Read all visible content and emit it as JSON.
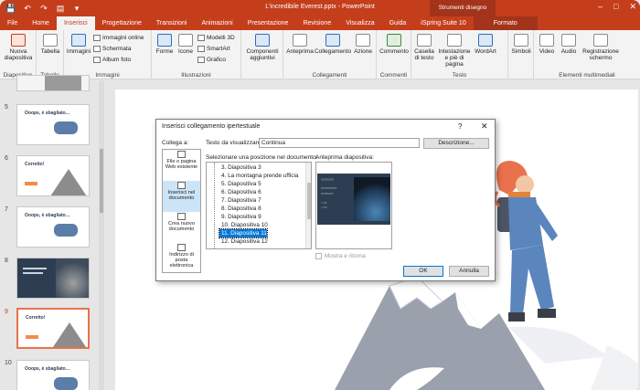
{
  "window": {
    "title": "L'incredibile Everest.pptx - PowerPoint",
    "context_group": "Strumenti disegno",
    "controls": [
      "–",
      "□",
      "✕"
    ]
  },
  "qat": [
    "💾",
    "↶",
    "↷",
    "▤",
    "▾"
  ],
  "tabs": [
    "File",
    "Home",
    "Inserisci",
    "Progettazione",
    "Transizioni",
    "Animazioni",
    "Presentazione",
    "Revisione",
    "Visualizza",
    "Guida",
    "iSpring Suite 10",
    "Formato"
  ],
  "ribbon": {
    "groups": {
      "diapositive": "Diapositive",
      "tabelle": "Tabelle",
      "immagini": "Immagini",
      "illustrazioni": "Illustrazioni",
      "collegamenti": "Collegamenti",
      "commenti": "Commenti",
      "testo": "Testo",
      "multimedia": "Elementi multimediali"
    },
    "nuova_diapositiva": "Nuova diapositiva",
    "tabella": "Tabella",
    "immagini": "Immagini",
    "immagini_online": "Immagini online",
    "schermata": "Schermata",
    "album_foto": "Album foto",
    "forme": "Forme",
    "icone": "Icone",
    "modelli_3d": "Modelli 3D",
    "smartart": "SmartArt",
    "grafico": "Grafico",
    "componenti": "Componenti aggiuntivi",
    "anteprima": "Anteprima",
    "collegamento": "Collegamento",
    "azione": "Azione",
    "commento": "Commento",
    "casella_testo": "Casella di testo",
    "intestazione": "Intestazione e piè di pagina",
    "wordart": "WordArt",
    "simboli": "Simboli",
    "video": "Video",
    "audio": "Audio",
    "registrazione": "Registrazione schermo"
  },
  "slides": [
    {
      "num": "5",
      "title": "Ooops, è sbagliato…"
    },
    {
      "num": "6",
      "title": "Corretto!"
    },
    {
      "num": "7",
      "title": "Ooops, è sbagliato…"
    },
    {
      "num": "8",
      "title": ""
    },
    {
      "num": "9",
      "title": "Corretto!"
    },
    {
      "num": "10",
      "title": "Ooops, è sbagliato…"
    }
  ],
  "dialog": {
    "title": "Inserisci collegamento ipertestuale",
    "help": "?",
    "close": "✕",
    "link_to_label": "Collega a:",
    "text_label": "Testo da visualizzare:",
    "text_value": "Continua",
    "screentip_button": "Descrizione...",
    "link_options": [
      "File o pagina Web esistente",
      "Inserisci nel documento",
      "Crea nuovo documento",
      "Indirizzo di posta elettronica"
    ],
    "doc_list_label": "Selezionare una posizione nel documento:",
    "doc_items": [
      "3. Diapositiva 3",
      "4. La montagna prende ufficia",
      "5. Diapositiva 5",
      "6. Diapositiva 6",
      "7. Diapositiva 7",
      "8. Diapositiva 8",
      "9. Diapositiva 9",
      "10. Diapositiva 10",
      "11. Diapositiva 11",
      "12. Diapositiva 12"
    ],
    "selected_item": "11. Diapositiva 11",
    "preview_label": "Anteprima diapositiva:",
    "show_return": "Mostra e ritorna",
    "ok": "OK",
    "cancel": "Annulla"
  },
  "colors": {
    "accent": "#c43e1c",
    "selection": "#0078d7",
    "slide_dark": "#2d3e52",
    "orange": "#f28b4b"
  }
}
